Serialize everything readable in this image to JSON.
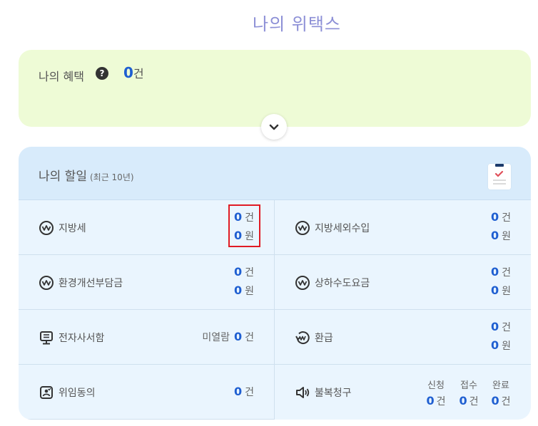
{
  "page_title": "나의 위택스",
  "benefit": {
    "label": "나의 혜택",
    "help": "?",
    "count": "0",
    "unit": "건"
  },
  "todo": {
    "title": "나의 할일",
    "period": "(최근 10년)",
    "items": [
      {
        "name": "지방세",
        "count": "0",
        "count_unit": "건",
        "amount": "0",
        "amount_unit": "원"
      },
      {
        "name": "지방세외수입",
        "count": "0",
        "count_unit": "건",
        "amount": "0",
        "amount_unit": "원"
      },
      {
        "name": "환경개선부담금",
        "count": "0",
        "count_unit": "건",
        "amount": "0",
        "amount_unit": "원"
      },
      {
        "name": "상하수도요금",
        "count": "0",
        "count_unit": "건",
        "amount": "0",
        "amount_unit": "원"
      },
      {
        "name": "전자사서함",
        "prefix": "미열람",
        "count": "0",
        "count_unit": "건"
      },
      {
        "name": "환급",
        "count": "0",
        "count_unit": "건",
        "amount": "0",
        "amount_unit": "원"
      },
      {
        "name": "위임동의",
        "count": "0",
        "count_unit": "건"
      },
      {
        "name": "불복청구",
        "stages": [
          {
            "label": "신청",
            "count": "0",
            "unit": "건"
          },
          {
            "label": "접수",
            "count": "0",
            "unit": "건"
          },
          {
            "label": "완료",
            "count": "0",
            "unit": "건"
          }
        ]
      }
    ]
  },
  "colors": {
    "accent": "#1f5fd1",
    "title": "#8c8fd6",
    "benefit_bg": "#eefbd6",
    "todo_bg": "#eaf5fe",
    "highlight": "#e01b24"
  },
  "icons": [
    "help-icon",
    "chevron-down-icon",
    "clipboard-check-icon",
    "won-coin-icon",
    "kiosk-icon",
    "refund-icon",
    "consent-icon",
    "megaphone-icon"
  ]
}
